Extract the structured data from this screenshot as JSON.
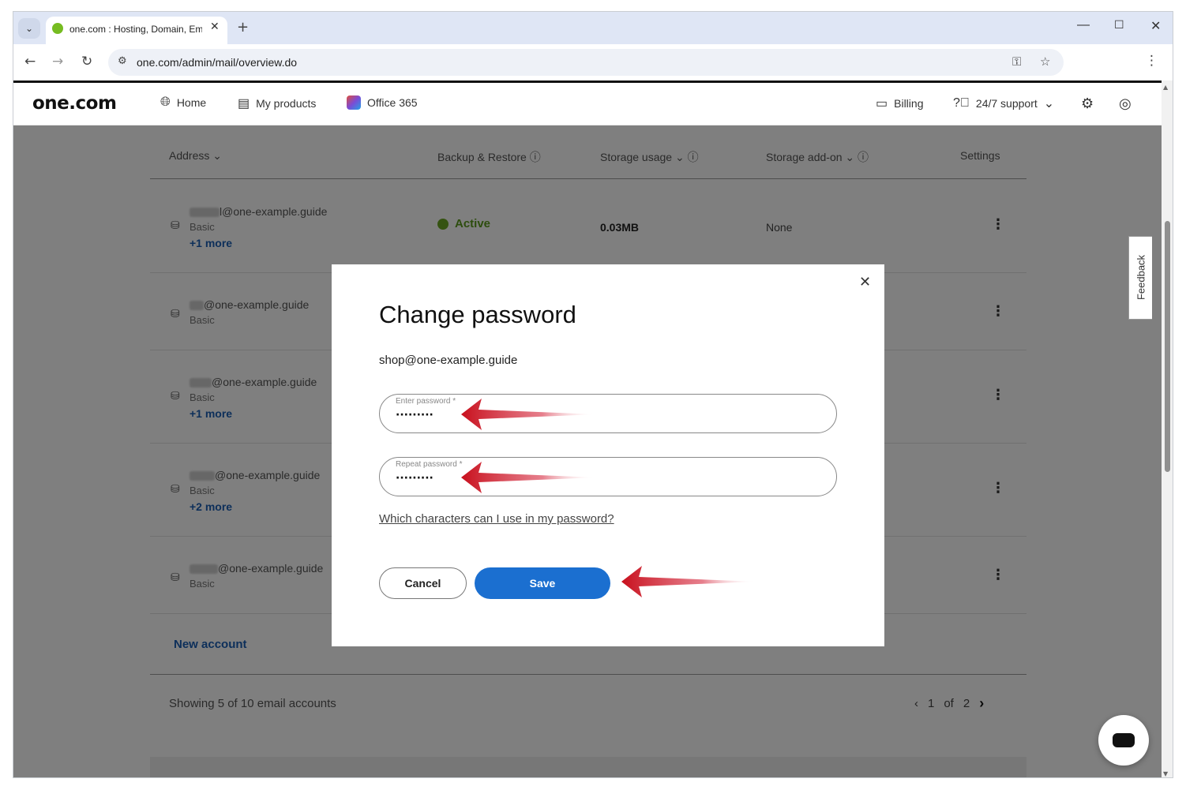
{
  "browser": {
    "tab_title": "one.com : Hosting, Domain, Em",
    "tab_close": "✕",
    "new_tab": "+",
    "url": "one.com/admin/mail/overview.do"
  },
  "site_nav": {
    "logo": "one.com",
    "home": "Home",
    "my_products": "My products",
    "office365": "Office 365",
    "billing": "Billing",
    "support": "24/7 support"
  },
  "table": {
    "columns": {
      "address": "Address",
      "backup": "Backup & Restore",
      "storage_usage": "Storage usage",
      "storage_addon": "Storage add-on",
      "settings": "Settings"
    },
    "rows": [
      {
        "address": "l@one-example.guide",
        "plan": "Basic",
        "more": "+1 more",
        "status": "Active",
        "usage": "0.03MB",
        "addon": "None"
      },
      {
        "address": "@one-example.guide",
        "plan": "Basic",
        "more": ""
      },
      {
        "address": "@one-example.guide",
        "plan": "Basic",
        "more": "+1 more"
      },
      {
        "address": "@one-example.guide",
        "plan": "Basic",
        "more": "+2 more"
      },
      {
        "address": "@one-example.guide",
        "plan": "Basic",
        "more": ""
      }
    ],
    "new_account": "New account",
    "showing": "Showing 5 of 10 email accounts",
    "pager": {
      "current": "1",
      "of": "of",
      "total": "2"
    }
  },
  "feedback": "Feedback",
  "modal": {
    "title": "Change password",
    "email": "shop@one-example.guide",
    "password_label": "Enter password *",
    "password_value": "·········",
    "repeat_label": "Repeat password *",
    "repeat_value": "·········",
    "help_link": "Which characters can I use in my password?",
    "cancel": "Cancel",
    "save": "Save"
  },
  "colors": {
    "brand_green": "#76bc21",
    "primary_blue": "#1b6fd0",
    "arrow_red": "#d0101e"
  }
}
